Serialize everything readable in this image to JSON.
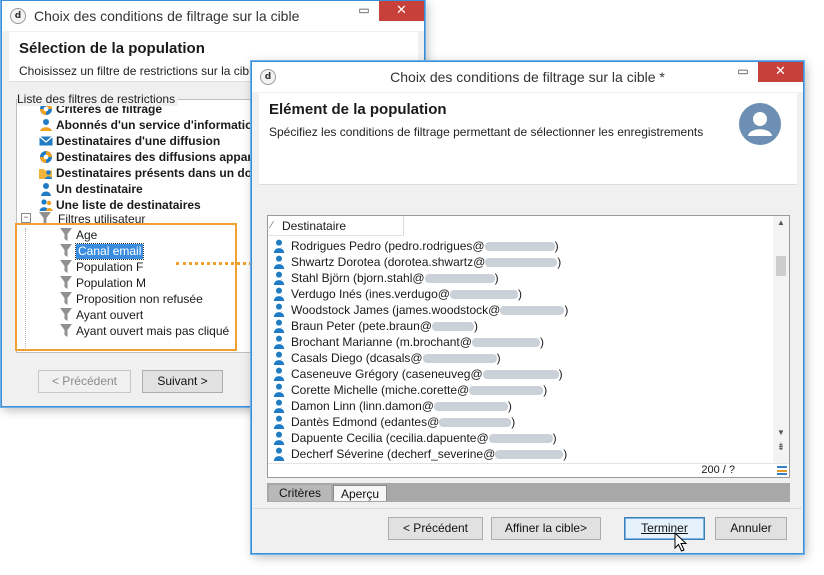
{
  "back_window": {
    "title": "Choix des conditions de filtrage sur la cible",
    "close": "✕",
    "minimize": "▭",
    "header_title": "Sélection de la population",
    "header_desc": "Choisissez un filtre de restrictions sur la cible",
    "list_label": "Liste des filtres de restrictions",
    "filters": [
      {
        "label": "Critères de filtrage",
        "icon": "criteria-icon"
      },
      {
        "label": "Abonnés d'un service d'informations",
        "icon": "subscription-icon"
      },
      {
        "label": "Destinataires d'une diffusion",
        "icon": "envelope-icon"
      },
      {
        "label": "Destinataires des diffusions appartenant",
        "icon": "criteria-icon"
      },
      {
        "label": "Destinataires présents dans un dossier",
        "icon": "folder-user-icon"
      },
      {
        "label": "Un destinataire",
        "icon": "user-icon"
      },
      {
        "label": "Une liste de destinataires",
        "icon": "users-icon"
      }
    ],
    "user_filters": {
      "label": "Filtres utilisateur",
      "toggle": "⊟",
      "items": [
        "Age",
        "Canal email",
        "Population F",
        "Population M",
        "Proposition non refusée",
        "Ayant ouvert",
        "Ayant ouvert mais pas cliqué"
      ]
    },
    "buttons": {
      "previous": "< Précédent",
      "next": "Suivant >"
    }
  },
  "front_window": {
    "title": "Choix des conditions de filtrage sur la cible *",
    "close": "✕",
    "minimize": "▭",
    "header_title": "Elément de la population",
    "header_desc": "Spécifiez les conditions de filtrage permettant de sélectionner les enregistrements",
    "grid": {
      "column_header": "Destinataire",
      "sort_marker": "⁄",
      "rows": [
        "Rodrigues Pedro (pedro.rodrigues@",
        "Shwartz Dorotea (dorotea.shwartz@",
        "Stahl Björn (bjorn.stahl@",
        "Verdugo Inés (ines.verdugo@",
        "Woodstock James (james.woodstock@",
        "Braun Peter (pete.braun@",
        "Brochant Marianne (m.brochant@",
        "Casals Diego (dcasals@",
        "Caseneuve Grégory (caseneuveg@",
        "Corette Michelle (miche.corette@",
        "Damon Linn (linn.damon@",
        "Dantès Edmond (edantes@",
        "Dapuente Cecilia (cecilia.dapuente@",
        "Decherf Séverine (decherf_severine@"
      ],
      "row_suffix": ")",
      "count": "200 / ?",
      "scroll_up": "▲",
      "scroll_down": "▼",
      "scroll_end": "⇟"
    },
    "tabs": [
      "Critères",
      "Aperçu"
    ],
    "buttons": {
      "previous": "< Précédent",
      "refine": "Affiner la cible>",
      "finish": "Terminer",
      "cancel": "Annuler"
    }
  },
  "colors": {
    "accent_blue": "#1e7bc4",
    "highlight_orange": "#f0a030",
    "close_red": "#c7403a"
  }
}
